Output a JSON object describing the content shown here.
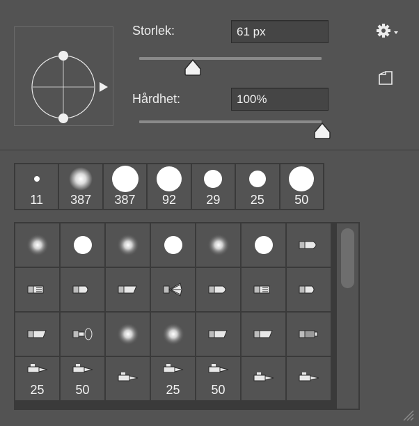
{
  "size": {
    "label": "Storlek:",
    "value": "61 px"
  },
  "hardness": {
    "label": "Hårdhet:",
    "value": "100%"
  },
  "presets": [
    {
      "type": "hard",
      "size_value": "11"
    },
    {
      "type": "soft",
      "size_value": "387"
    },
    {
      "type": "hard",
      "size_value": "387"
    },
    {
      "type": "hard",
      "size_value": "92"
    },
    {
      "type": "hard",
      "size_value": "29"
    },
    {
      "type": "hard",
      "size_value": "25"
    },
    {
      "type": "hard",
      "size_value": "50"
    }
  ],
  "brush_grid": [
    {
      "icon": "soft-round-brush-icon",
      "kind": "soft",
      "label": ""
    },
    {
      "icon": "hard-round-brush-icon",
      "kind": "hard",
      "label": ""
    },
    {
      "icon": "soft-round-brush-icon",
      "kind": "soft",
      "label": ""
    },
    {
      "icon": "hard-round-brush-icon",
      "kind": "hard",
      "label": ""
    },
    {
      "icon": "soft-round-brush-icon",
      "kind": "soft",
      "label": ""
    },
    {
      "icon": "hard-round-brush-icon",
      "kind": "hard",
      "label": ""
    },
    {
      "icon": "round-tip-bristle-brush-icon",
      "kind": "tool",
      "label": ""
    },
    {
      "icon": "flat-bristle-brush-icon",
      "kind": "tool",
      "label": ""
    },
    {
      "icon": "round-bristle-brush-icon",
      "kind": "tool",
      "label": ""
    },
    {
      "icon": "angled-bristle-brush-icon",
      "kind": "tool",
      "label": ""
    },
    {
      "icon": "fan-brush-icon",
      "kind": "tool",
      "label": ""
    },
    {
      "icon": "point-erodible-brush-icon",
      "kind": "tool",
      "label": ""
    },
    {
      "icon": "flat-erodible-brush-icon",
      "kind": "tool",
      "label": ""
    },
    {
      "icon": "round-erodible-brush-icon",
      "kind": "tool",
      "label": ""
    },
    {
      "icon": "angled-erodible-brush-icon",
      "kind": "tool",
      "label": ""
    },
    {
      "icon": "airbrush-icon",
      "kind": "tool",
      "label": ""
    },
    {
      "icon": "soft-round-brush-icon",
      "kind": "soft",
      "label": ""
    },
    {
      "icon": "soft-round-brush-icon",
      "kind": "soft",
      "label": ""
    },
    {
      "icon": "angled-erodible-brush-icon",
      "kind": "tool",
      "label": ""
    },
    {
      "icon": "angled-erodible-brush-icon",
      "kind": "tool",
      "label": ""
    },
    {
      "icon": "pencil-erodible-brush-icon",
      "kind": "tool",
      "label": ""
    },
    {
      "icon": "airbrush-pen-icon",
      "kind": "tool",
      "label": "25"
    },
    {
      "icon": "airbrush-pen-icon",
      "kind": "tool",
      "label": "50"
    },
    {
      "icon": "airbrush-pen-icon",
      "kind": "tool",
      "label": ""
    },
    {
      "icon": "airbrush-pen-icon",
      "kind": "tool",
      "label": "25"
    },
    {
      "icon": "airbrush-pen-icon",
      "kind": "tool",
      "label": "50"
    },
    {
      "icon": "airbrush-pen-icon",
      "kind": "tool",
      "label": ""
    },
    {
      "icon": "airbrush-pen-icon",
      "kind": "tool",
      "label": ""
    }
  ],
  "icons": {
    "settings": "gear-icon",
    "new_preset": "new-preset-icon",
    "resize": "resize-grip-icon"
  }
}
